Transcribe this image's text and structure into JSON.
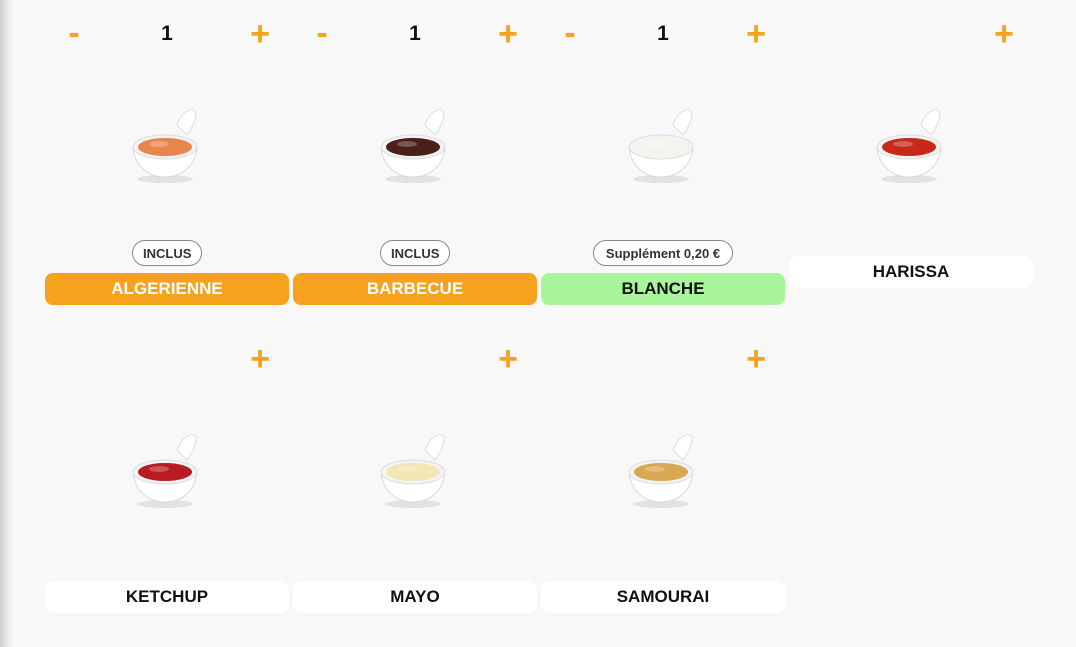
{
  "colors": {
    "accent": "#f5a31f",
    "supplement": "#a9f59b",
    "card_bg": "#ffffff"
  },
  "sauces": [
    {
      "name": "ALGERIENNE",
      "qty": "1",
      "badge": "INCLUS",
      "state": "inclus",
      "color": "#e8854c"
    },
    {
      "name": "BARBECUE",
      "qty": "1",
      "badge": "INCLUS",
      "state": "inclus",
      "color": "#4a1f18"
    },
    {
      "name": "BLANCHE",
      "qty": "1",
      "badge": "Supplément 0,20 €",
      "state": "supp",
      "color": "#f4f4ee"
    },
    {
      "name": "HARISSA",
      "qty": "",
      "badge": "",
      "state": "plain",
      "color": "#c8281a"
    },
    {
      "name": "KETCHUP",
      "qty": "",
      "badge": "",
      "state": "plain",
      "color": "#b81c22"
    },
    {
      "name": "MAYO",
      "qty": "",
      "badge": "",
      "state": "plain",
      "color": "#f3e6b4"
    },
    {
      "name": "SAMOURAI",
      "qty": "",
      "badge": "",
      "state": "plain",
      "color": "#d9a652"
    }
  ],
  "controls": {
    "minus_label": "-",
    "plus_label": "+"
  }
}
